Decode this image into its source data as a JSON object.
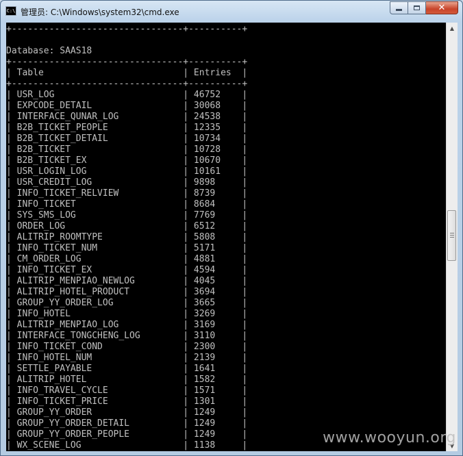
{
  "window": {
    "title": "管理员: C:\\Windows\\system32\\cmd.exe",
    "icon_text": "C:\\"
  },
  "console": {
    "lines": [
      "+--------------------------------+----------+",
      "",
      "Database: SAAS18",
      "+--------------------------------+----------+",
      "| Table                          | Entries  |",
      "+--------------------------------+----------+",
      "| USR_LOG                        | 46752    |",
      "| EXPCODE_DETAIL                 | 30068    |",
      "| INTERFACE_QUNAR_LOG            | 24538    |",
      "| B2B_TICKET_PEOPLE              | 12335    |",
      "| B2B_TICKET_DETAIL              | 10734    |",
      "| B2B_TICKET                     | 10728    |",
      "| B2B_TICKET_EX                  | 10670    |",
      "| USR_LOGIN_LOG                  | 10161    |",
      "| USR_CREDIT_LOG                 | 9898     |",
      "| INFO_TICKET_RELVIEW            | 8739     |",
      "| INFO_TICKET                    | 8684     |",
      "| SYS_SMS_LOG                    | 7769     |",
      "| ORDER_LOG                      | 6512     |",
      "| ALITRIP_ROOMTYPE               | 5808     |",
      "| INFO_TICKET_NUM                | 5171     |",
      "| CM_ORDER_LOG                   | 4881     |",
      "| INFO_TICKET_EX                 | 4594     |",
      "| ALITRIP_MENPIAO_NEWLOG         | 4045     |",
      "| ALITRIP_HOTEL_PRODUCT          | 3694     |",
      "| GROUP_YY_ORDER_LOG             | 3665     |",
      "| INFO_HOTEL                     | 3269     |",
      "| ALITRIP_MENPIAO_LOG            | 3169     |",
      "| INTERFACE_TONGCHENG_LOG        | 3110     |",
      "| INFO_TICKET_COND               | 2300     |",
      "| INFO_HOTEL_NUM                 | 2139     |",
      "| SETTLE_PAYABLE                 | 1641     |",
      "| ALITRIP_HOTEL                  | 1582     |",
      "| INFO_TRAVEL_CYCLE              | 1571     |",
      "| INFO_TICKET_PRICE              | 1301     |",
      "| GROUP_YY_ORDER                 | 1249     |",
      "| GROUP_YY_ORDER_DETAIL          | 1249     |",
      "| GROUP_YY_ORDER_PEOPLE          | 1249     |",
      "| WX_SCENE_LOG                   | 1138     |"
    ]
  },
  "watermark": "www.wooyun.org",
  "icons": {
    "app": "cmd-app-icon",
    "minimize": "minimize-icon",
    "maximize": "maximize-icon",
    "close": "close-icon",
    "scroll_up": "scroll-up-arrow-icon",
    "scroll_down": "scroll-down-arrow-icon"
  },
  "colors": {
    "console_background": "#000000",
    "console_text": "#c0c0c0",
    "close_button": "#c8442a"
  }
}
